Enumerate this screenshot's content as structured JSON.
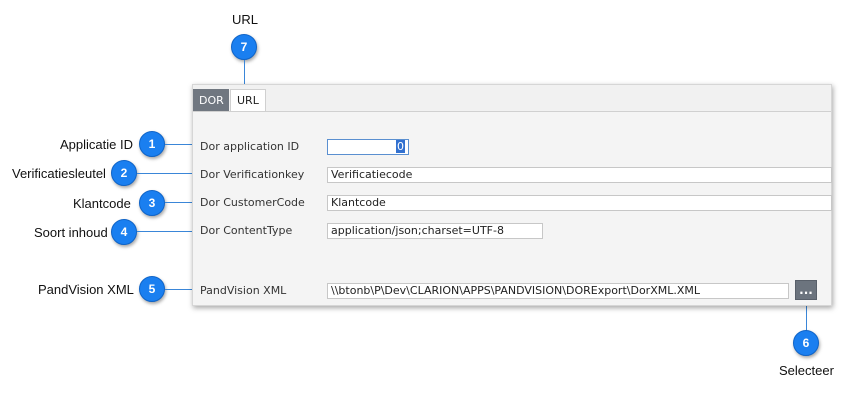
{
  "callouts": {
    "url": "URL",
    "applicatie_id": "Applicatie ID",
    "verificatiesleutel": "Verificatiesleutel",
    "klantcode": "Klantcode",
    "soort_inhoud": "Soort inhoud",
    "pandvision_xml": "PandVision XML",
    "selecteer": "Selecteer"
  },
  "badges": [
    "1",
    "2",
    "3",
    "4",
    "5",
    "6",
    "7"
  ],
  "tabs": [
    {
      "label": "DOR",
      "active": true
    },
    {
      "label": "URL",
      "active": false
    }
  ],
  "form": {
    "app_id": {
      "label": "Dor application ID",
      "value": "0"
    },
    "verification_key": {
      "label": "Dor Verificationkey",
      "value": "Verificatiecode"
    },
    "customer_code": {
      "label": "Dor CustomerCode",
      "value": "Klantcode"
    },
    "content_type": {
      "label": "Dor ContentType",
      "value": "application/json;charset=UTF-8"
    },
    "xml_path": {
      "label": "PandVision XML",
      "value": "\\\\btonb\\P\\Dev\\CLARION\\APPS\\PANDVISION\\DORExport\\DorXML.XML"
    },
    "browse_label": "..."
  },
  "colors": {
    "badge": "#1a7ff0",
    "active_tab": "#707780",
    "button": "#6c747e"
  }
}
